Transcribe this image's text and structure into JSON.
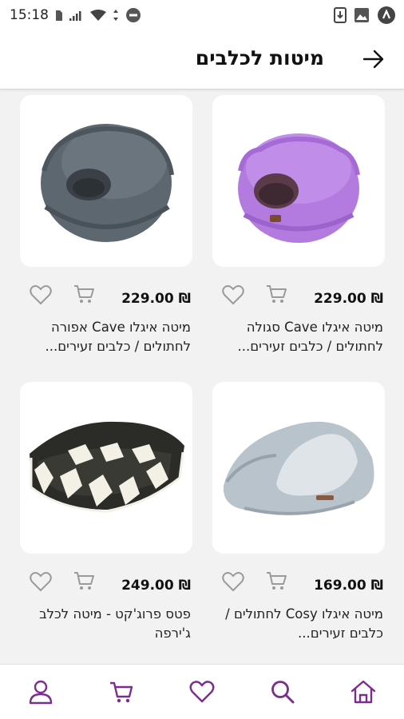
{
  "status_bar": {
    "time": "15:18",
    "icons": [
      "sim-icon",
      "signal-icon",
      "wifi-icon",
      "data-arrows-icon",
      "dnd-icon",
      "download-icon",
      "image-icon",
      "app-badge-icon"
    ]
  },
  "header": {
    "title": "מיטות לכלבים",
    "back_icon": "arrow-right-icon"
  },
  "colors": {
    "accent": "#7b2d8e",
    "icon_gray": "#9a9a9a",
    "background": "#f2f2f2"
  },
  "products": [
    {
      "name": "מיטה איגלו Cave סגולה לחתולים / כלבים זעירים...",
      "price": "229.00 ₪",
      "image": "purple-cave-bed"
    },
    {
      "name": "מיטה איגלו Cave אפורה לחתולים / כלבים זעירים...",
      "price": "229.00 ₪",
      "image": "gray-cave-bed"
    },
    {
      "name": "מיטה איגלו Cosy לחתולים / כלבים זעירים...",
      "price": "169.00 ₪",
      "image": "cosy-igloo-bed"
    },
    {
      "name": "פטס פרוג'קט - מיטה לכלב ג'ירפה",
      "price": "249.00 ₪",
      "image": "giraffe-dog-bed"
    }
  ],
  "bottom_nav": [
    "home-icon",
    "search-icon",
    "heart-icon",
    "cart-icon",
    "user-icon"
  ]
}
